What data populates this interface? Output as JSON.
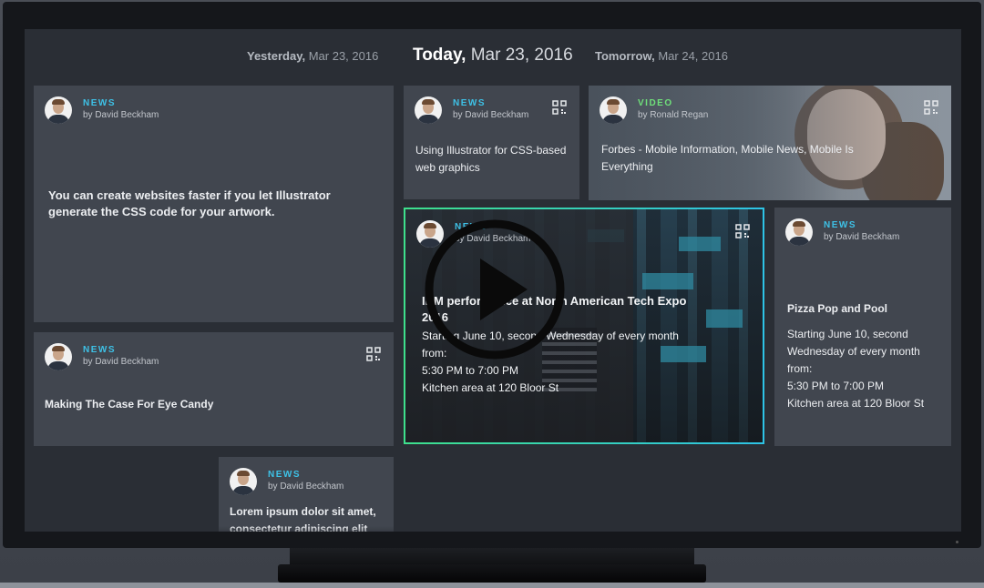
{
  "date_nav": {
    "yesterday_day": "Yesterday,",
    "yesterday_date": "Mar 23, 2016",
    "today_day": "Today,",
    "today_date": "Mar 23, 2016",
    "tomorrow_day": "Tomorrow,",
    "tomorrow_date": "Mar 24, 2016"
  },
  "cards": [
    {
      "category": "NEWS",
      "author": "by David Beckham",
      "text": "You can create websites faster if you let Illustrator generate the CSS code for your artwork."
    },
    {
      "category": "NEWS",
      "author": "by David Beckham",
      "text": "Using Illustrator for CSS-based web graphics"
    },
    {
      "category": "VIDEO",
      "author": "by Ronald Regan",
      "text": "Forbes - Mobile Information, Mobile News, Mobile Is Everything"
    },
    {
      "category": "NEWS",
      "author": "by David Beckham",
      "text": "Making The Case For Eye Candy"
    },
    {
      "category": "NEWS",
      "author": "by David Beckham",
      "title": "IBM performance at North American Tech Expo 2016",
      "details": [
        "Starting June 10, second Wednesday of every month",
        "from:",
        "5:30 PM to 7:00 PM",
        "Kitchen area at 120 Bloor St"
      ]
    },
    {
      "category": "NEWS",
      "author": "by David Beckham",
      "title": "Pizza Pop and Pool",
      "details": [
        "Starting June 10, second Wednesday of every month",
        "from:",
        "5:30 PM to 7:00 PM",
        "Kitchen area at 120 Bloor St"
      ]
    },
    {
      "category": "NEWS",
      "author": "by David Beckham",
      "text": "Lorem ipsum dolor sit amet, consectetur adipiscing elit"
    }
  ],
  "colors": {
    "news_accent": "#3ec1e6",
    "video_accent": "#6fe07a",
    "card_bg": "#41464f",
    "screen_bg": "#2a2e35"
  },
  "icons": {
    "qr": "qr-code-icon",
    "play": "play-icon",
    "avatar": "author-avatar"
  }
}
